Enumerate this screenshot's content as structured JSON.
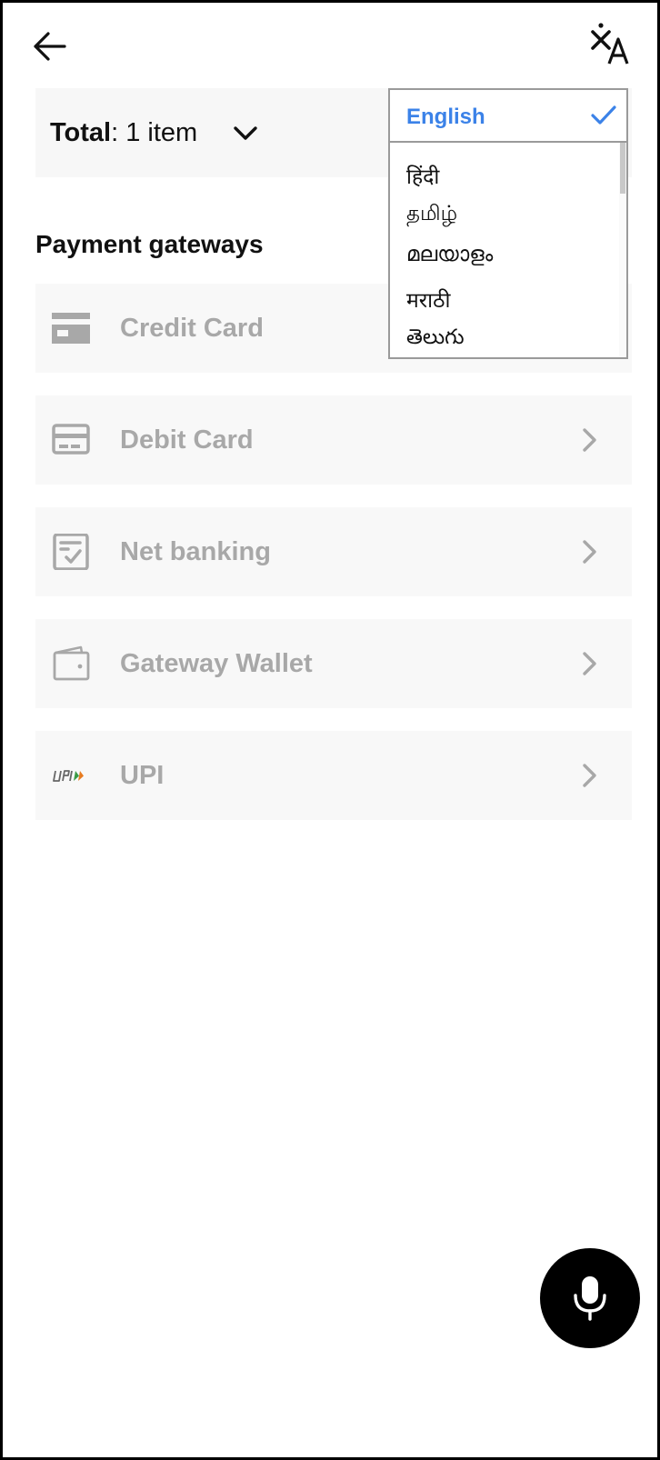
{
  "header": {
    "back_icon": "arrow-left-icon",
    "translate_icon": "translate-icon"
  },
  "total": {
    "label": "Total",
    "colon": ":",
    "value": "1 item"
  },
  "payment": {
    "section_title": "Payment gateways",
    "methods": [
      {
        "label": "Credit Card",
        "icon": "credit-card-icon"
      },
      {
        "label": "Debit Card",
        "icon": "debit-card-icon"
      },
      {
        "label": "Net banking",
        "icon": "net-banking-icon"
      },
      {
        "label": "Gateway Wallet",
        "icon": "wallet-icon"
      },
      {
        "label": "UPI",
        "icon": "upi-icon"
      }
    ]
  },
  "language": {
    "selected": "English",
    "options": [
      "हिंदी",
      "தமிழ்",
      "മലയാളം",
      "मराठी",
      "తెలుగు"
    ]
  },
  "colors": {
    "accent": "#3b82e8",
    "row_bg": "#f8f8f8",
    "disabled_text": "#a8a8a8",
    "fab_bg": "#000000"
  },
  "fab": {
    "icon": "microphone-icon"
  }
}
